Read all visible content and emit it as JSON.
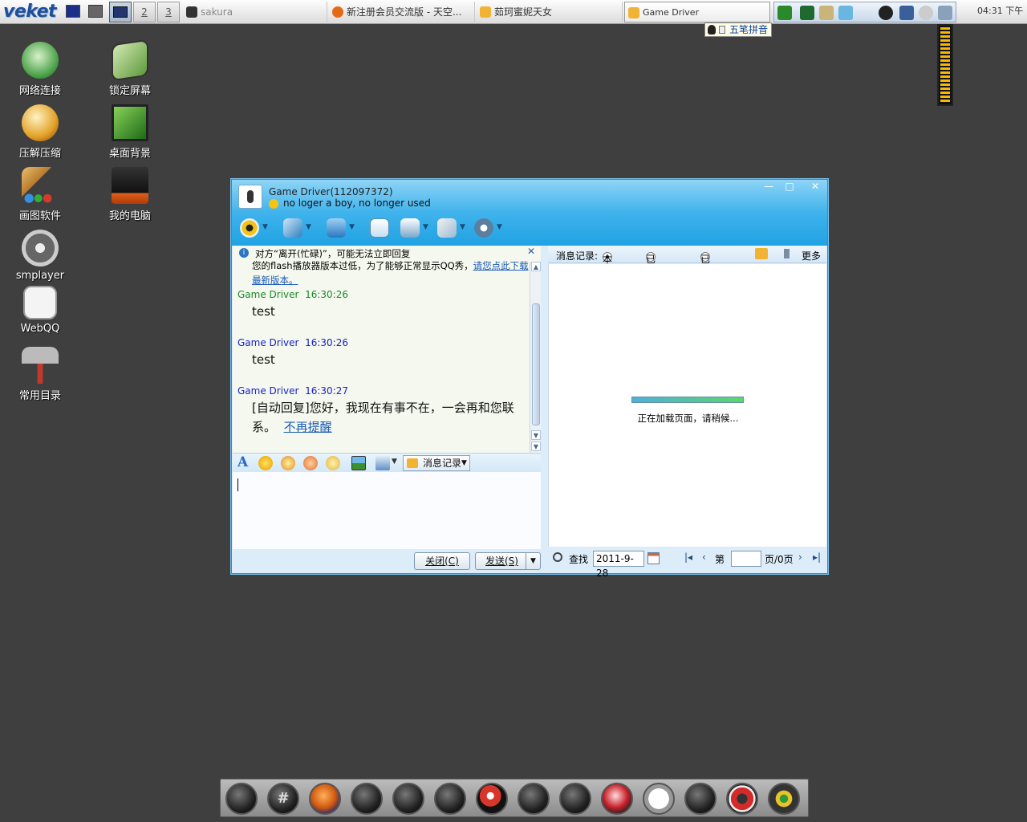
{
  "taskbar": {
    "logo": "veket",
    "workspaces": [
      "2",
      "3"
    ],
    "tasks": [
      {
        "label": "sakura"
      },
      {
        "label": "新注册会员交流版 - 天空..."
      },
      {
        "label": "茹珂蜜妮天女"
      },
      {
        "label": "Game  Driver"
      }
    ],
    "clock": "04:31  下午"
  },
  "ime": {
    "label": "五笔拼音"
  },
  "desktop": {
    "icons": [
      {
        "label": "网络连接"
      },
      {
        "label": "锁定屏幕"
      },
      {
        "label": "压解压缩"
      },
      {
        "label": "桌面背景"
      },
      {
        "label": "画图软件"
      },
      {
        "label": "我的电脑"
      },
      {
        "label": "smplayer"
      },
      {
        "label": "WebQQ"
      },
      {
        "label": "常用目录"
      }
    ]
  },
  "qq": {
    "title": "Game Driver(112097372)",
    "signature": "no loger a boy, no longer used",
    "notice": {
      "line1": "对方“离开(忙碌)”，可能无法立即回复",
      "line2": "您的flash播放器版本过低，为了能够正常显示QQ秀，",
      "link": "请您点此下载最新版本。"
    },
    "messages": [
      {
        "sender": "Game Driver",
        "time": "16:30:26",
        "text": "test",
        "color": "#1a8a2a"
      },
      {
        "sender": "Game Driver",
        "time": "16:30:26",
        "text": "test",
        "color": "#1a22c8"
      },
      {
        "sender": "Game Driver",
        "time": "16:30:27",
        "text": "[自动回复]您好，我现在有事不在，一会再和您联系。",
        "link": "不再提醒",
        "color": "#1a22c8"
      }
    ],
    "history_button": "消息记录",
    "close_button": "关闭(C)",
    "send_button": "发送(S)",
    "history": {
      "label": "消息记录:",
      "tabs": [
        "本地",
        "已漫游",
        "已上传"
      ],
      "more": "更多",
      "loading": "正在加载页面，请稍候...",
      "search_label": "查找",
      "date": "2011-9-28",
      "page_prefix": "第",
      "page_suffix": "页/0页"
    }
  },
  "colors": {
    "desktop": "#3f3f3f",
    "qq_header": "#20a2e3",
    "link": "#1a5bb8"
  }
}
